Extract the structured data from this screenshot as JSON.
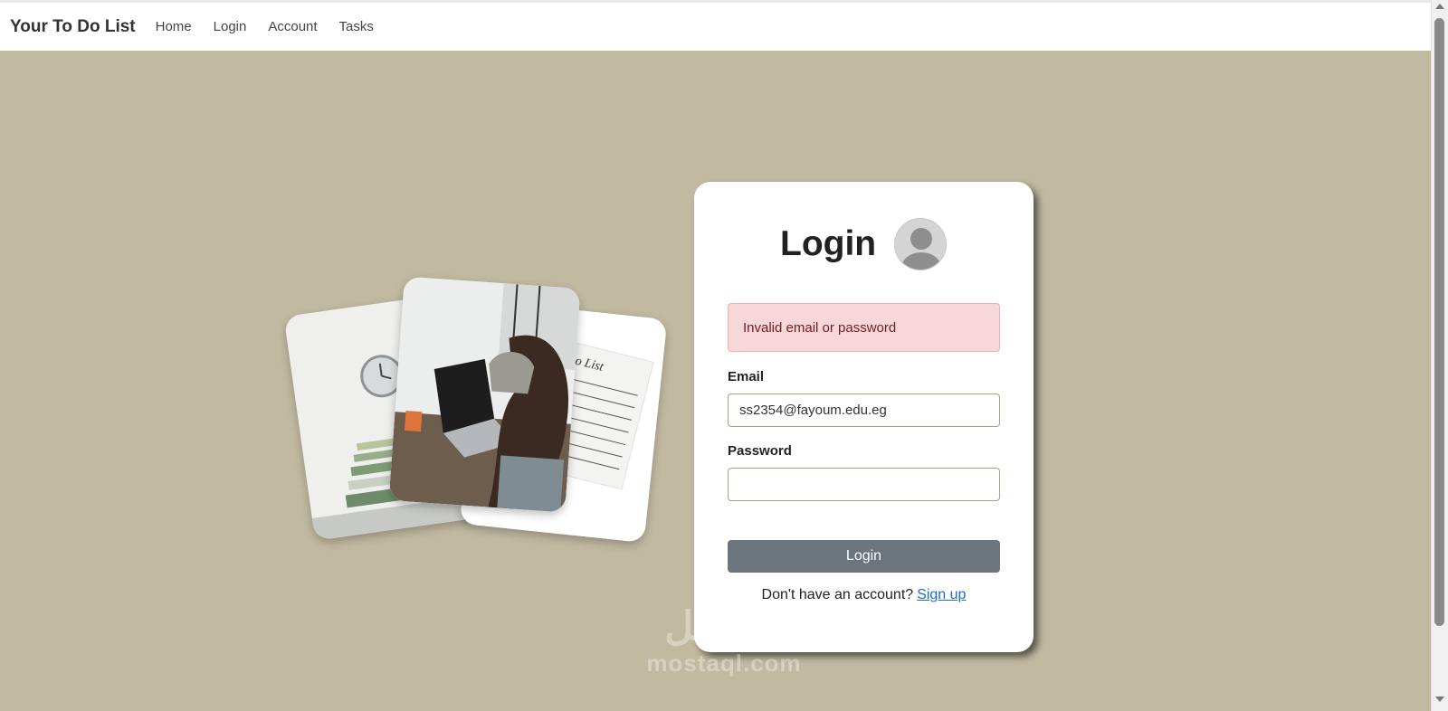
{
  "navbar": {
    "brand": "Your To Do List",
    "links": [
      "Home",
      "Login",
      "Account",
      "Tasks"
    ]
  },
  "login_card": {
    "title": "Login",
    "alert": "Invalid email or password",
    "email_label": "Email",
    "email_value": "ss2354@fayoum.edu.eg",
    "password_label": "Password",
    "password_value": "",
    "button_label": "Login",
    "signup_prompt": "Don't have an account?",
    "signup_link": "Sign up"
  },
  "photo_cards": {
    "right_card_text": "o List"
  },
  "watermark": {
    "script": "مستقل",
    "domain": "mostaql.com"
  },
  "colors": {
    "background": "#c1b9a0",
    "alert_bg": "#f8d7da",
    "button": "#6c757d",
    "link": "#1a6bd1"
  }
}
